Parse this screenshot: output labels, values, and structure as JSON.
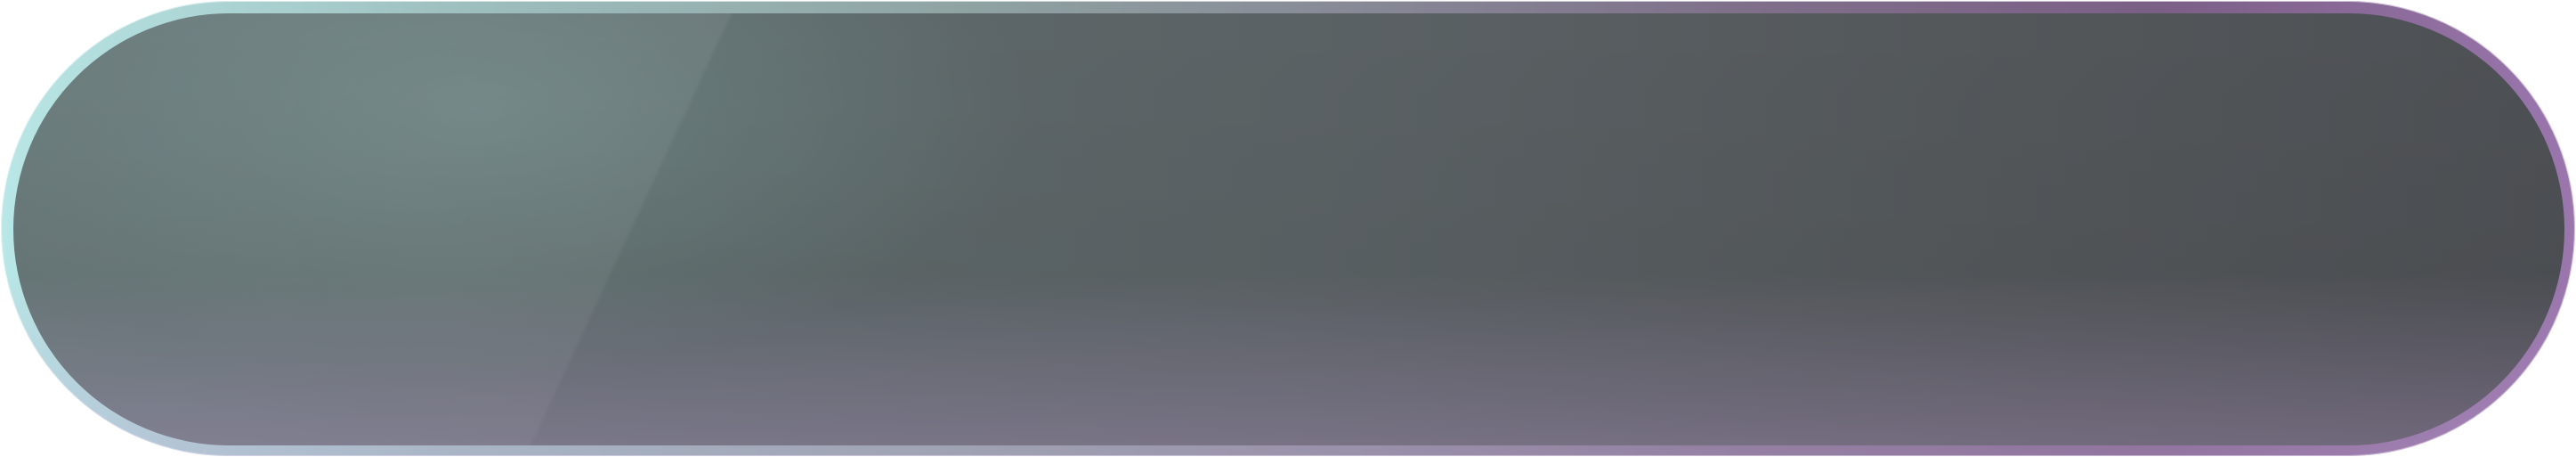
{
  "button": {
    "label": ""
  },
  "colors": {
    "border_left": "#b9e6e6",
    "border_right": "#9a76ad",
    "face_left": "#5d6e6f",
    "face_right": "#4d5054",
    "background": "#ffffff"
  }
}
